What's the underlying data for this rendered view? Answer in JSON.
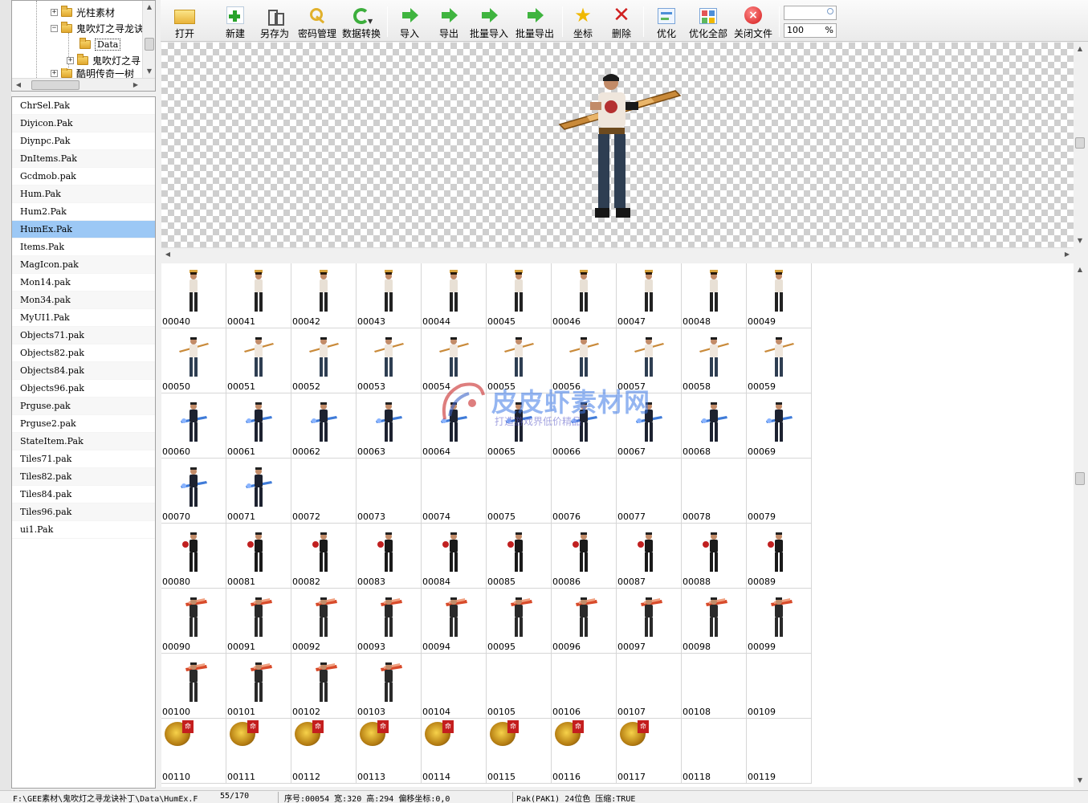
{
  "tree": {
    "items": [
      {
        "label": "光柱素材",
        "expander": "+"
      },
      {
        "label": "鬼吹灯之寻龙诀",
        "expander": "−"
      },
      {
        "label": "Data",
        "expander": ""
      },
      {
        "label": "鬼吹灯之寻",
        "expander": "+"
      },
      {
        "label": "酷明传奇一树",
        "expander": "+"
      }
    ]
  },
  "files": [
    "ChrSel.Pak",
    "Diyicon.Pak",
    "Diynpc.Pak",
    "DnItems.Pak",
    "Gcdmob.pak",
    "Hum.Pak",
    "Hum2.Pak",
    "HumEx.Pak",
    "Items.Pak",
    "MagIcon.pak",
    "Mon14.pak",
    "Mon34.pak",
    "MyUI1.Pak",
    "Objects71.pak",
    "Objects82.pak",
    "Objects84.pak",
    "Objects96.pak",
    "Prguse.pak",
    "Prguse2.pak",
    "StateItem.Pak",
    "Tiles71.pak",
    "Tiles82.pak",
    "Tiles84.pak",
    "Tiles96.pak",
    "ui1.Pak"
  ],
  "selected_file": "HumEx.Pak",
  "toolbar": {
    "open": "打开",
    "new": "新建",
    "save_as": "另存为",
    "password": "密码管理",
    "convert": "数据转换",
    "import": "导入",
    "export": "导出",
    "batch_import": "批量导入",
    "batch_export": "批量导出",
    "coords": "坐标",
    "delete": "删除",
    "optimize": "优化",
    "optimize_all": "优化全部",
    "close_file": "关闭文件",
    "search_value": "",
    "zoom_value": "100",
    "zoom_unit": "%"
  },
  "grid": {
    "rows": [
      {
        "start": 40,
        "sprite": "male",
        "filled": 10
      },
      {
        "start": 50,
        "sprite": "sword",
        "filled": 10
      },
      {
        "start": 60,
        "sprite": "blue",
        "filled": 10
      },
      {
        "start": 70,
        "sprite": "blue",
        "filled": 2
      },
      {
        "start": 80,
        "sprite": "dark",
        "filled": 10
      },
      {
        "start": 90,
        "sprite": "red",
        "filled": 10
      },
      {
        "start": 100,
        "sprite": "red",
        "filled": 4
      },
      {
        "start": 110,
        "sprite": "medal",
        "filled": 8
      }
    ],
    "medal_tag": "命"
  },
  "watermark": {
    "title": "皮皮虾素材网",
    "subtitle": "打造游戏界低价精品"
  },
  "status": {
    "path": "F:\\GEE素材\\鬼吹灯之寻龙诀补丁\\Data\\HumEx.F",
    "count": "55/170",
    "info": "序号:00054 宽:320 高:294 偏移坐标:0,0",
    "format": "Pak(PAK1) 24位色 压缩:TRUE"
  },
  "colors": {
    "selection": "#9cc8f5",
    "watermark": "#3c78e6"
  }
}
